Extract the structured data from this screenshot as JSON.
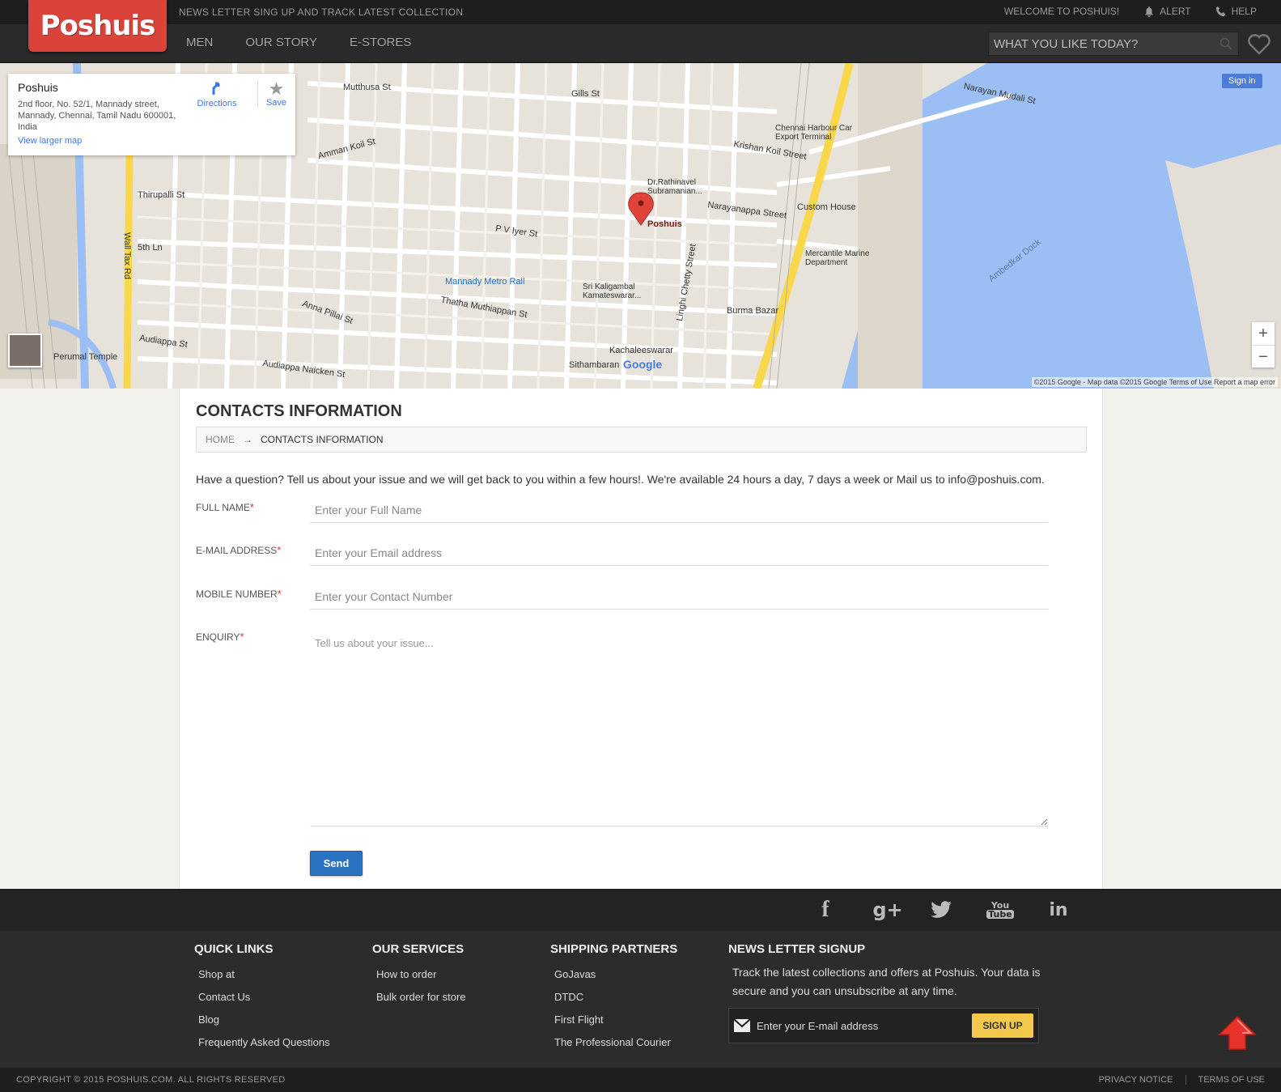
{
  "header": {
    "logo": "Poshuis",
    "tagline": "NEWS LETTER SING UP AND TRACK LATEST COLLECTION",
    "welcome": "WELCOME TO POSHUIS!",
    "alert": "ALERT",
    "help": "HELP",
    "nav": [
      "MEN",
      "OUR STORY",
      "E-STORES"
    ],
    "search_placeholder": "WHAT YOU LIKE TODAY?"
  },
  "map": {
    "place_name": "Poshuis",
    "address": "2nd floor, No. 52/1, Mannady street, Mannady, Chennai, Tamil Nadu 600001, India",
    "view_larger": "View larger map",
    "directions": "Directions",
    "save": "Save",
    "sign_in": "Sign in",
    "attribution": "©2015 Google - Map data ©2015 Google   Terms of Use   Report a map error",
    "google": "Google",
    "labels": [
      "Mutthusa St",
      "Gills St",
      "Narayan Mudali St",
      "Chennai Harbour Car Export Terminal",
      "Krishan Koil Street",
      "Amman Koil St",
      "Thirupalli St",
      "Dr.Rathinavel Subramanian...",
      "Narayanappa Street",
      "Custom House",
      "Poshuis",
      "P V Iyer St",
      "5th Ln",
      "Mercantile Marine Department",
      "Mannady Metro Rail",
      "Sri Kaligambal Kamateswarar...",
      "Ambedkar Dock",
      "Anna Pillai St",
      "Thatha Muthiappan St",
      "Burma Bazar",
      "Audiappa St",
      "Perumal Temple",
      "Kachaleeswarar",
      "Audiappa Naicken St",
      "Sithambaran",
      "Wall Tax Rd",
      "Linghi Chetty Street"
    ]
  },
  "contact": {
    "title": "CONTACTS INFORMATION",
    "breadcrumb_home": "HOME",
    "breadcrumb_current": "CONTACTS INFORMATION",
    "intro": "Have a question? Tell us about your issue and we will get back to you within a few hours!. We're available 24 hours a day, 7 days a week or Mail us to info@poshuis.com.",
    "fields": [
      {
        "label": "FULL NAME",
        "placeholder": "Enter your Full Name"
      },
      {
        "label": "E-MAIL ADDRESS",
        "placeholder": "Enter your Email address"
      },
      {
        "label": "MOBILE NUMBER",
        "placeholder": "Enter your Contact Number"
      },
      {
        "label": "ENQUIRY",
        "placeholder": "Tell us about your issue..."
      }
    ],
    "required_mark": "*",
    "send": "Send"
  },
  "social": [
    "facebook-icon",
    "google-plus-icon",
    "twitter-icon",
    "youtube-icon",
    "linkedin-icon"
  ],
  "footer": {
    "quick_links": {
      "title": "QUICK LINKS",
      "items": [
        "Shop at",
        "Contact Us",
        "Blog",
        "Frequently Asked Questions"
      ]
    },
    "services": {
      "title": "OUR SERVICES",
      "items": [
        "How to order",
        "Bulk order for store"
      ]
    },
    "shipping": {
      "title": "SHIPPING PARTNERS",
      "items": [
        "GoJavas",
        "DTDC",
        "First Flight",
        "The Professional Courier"
      ]
    },
    "newsletter": {
      "title": "NEWS LETTER SIGNUP",
      "text": "Track the latest collections and offers at Poshuis. Your data is secure and you can unsubscribe at any time.",
      "placeholder": "Enter your E-mail address",
      "button": "SIGN UP"
    },
    "copyright": "COPYRIGHT © 2015 POSHUIS.COM. ALL RIGHTS RESERVED",
    "privacy": "PRIVACY NOTICE",
    "terms": "TERMS OF USE"
  },
  "colors": {
    "brand_red": "#d9433a",
    "send_blue": "#2a73c3",
    "signup_yellow": "#f3c94c",
    "water_blue": "#9bbff4",
    "road_yellow": "#f9d74a"
  }
}
